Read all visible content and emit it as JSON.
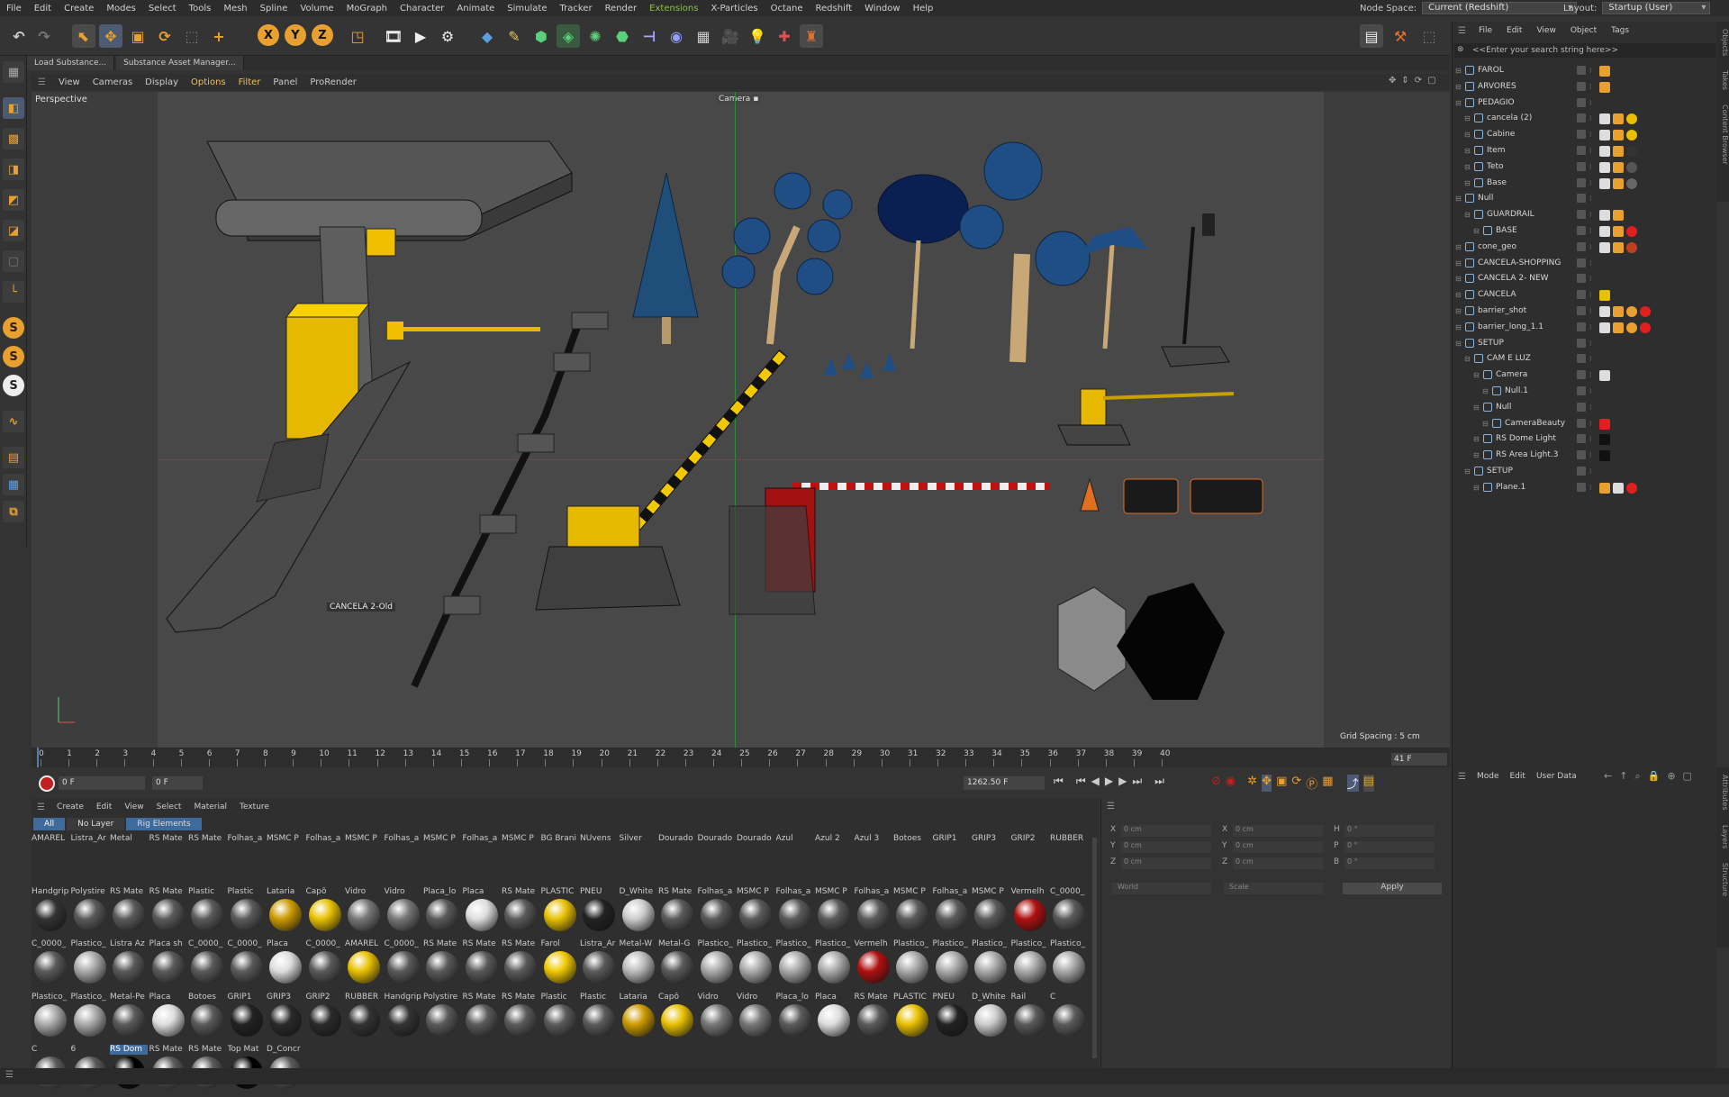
{
  "menubar": {
    "items": [
      "File",
      "Edit",
      "Create",
      "Modes",
      "Select",
      "Tools",
      "Mesh",
      "Spline",
      "Volume",
      "MoGraph",
      "Character",
      "Animate",
      "Simulate",
      "Tracker",
      "Render",
      "Extensions",
      "X-Particles",
      "Octane",
      "Redshift",
      "Window",
      "Help"
    ],
    "node_space_label": "Node Space:",
    "node_space_value": "Current (Redshift)",
    "layout_label": "Layout:",
    "layout_value": "Startup (User)"
  },
  "doc_tabs": [
    "Load Substance...",
    "Substance Asset Manager..."
  ],
  "viewport_menu": [
    "View",
    "Cameras",
    "Display",
    "Options",
    "Filter",
    "Panel",
    "ProRender"
  ],
  "viewport": {
    "name": "Perspective",
    "camera_label": "Camera",
    "grid_spacing": "Grid Spacing : 5 cm",
    "object_label": "CANCELA 2-Old"
  },
  "timeline": {
    "ticks": [
      "0",
      "1",
      "2",
      "3",
      "4",
      "5",
      "6",
      "7",
      "8",
      "9",
      "10",
      "11",
      "12",
      "13",
      "14",
      "15",
      "16",
      "17",
      "18",
      "19",
      "20",
      "21",
      "22",
      "23",
      "24",
      "25",
      "26",
      "27",
      "28",
      "29",
      "30",
      "31",
      "32",
      "33",
      "34",
      "35",
      "36",
      "37",
      "38",
      "39",
      "40"
    ],
    "end_frame": "41 F",
    "current_frame": "0 F",
    "start_field": "0 F",
    "end_field": "1262.50 F"
  },
  "object_manager": {
    "menu": [
      "File",
      "Edit",
      "View",
      "Object",
      "Tags"
    ],
    "search_placeholder": "<<Enter your search string here>>",
    "objects": [
      {
        "name": "FAROL",
        "indent": 0
      },
      {
        "name": "ARVORES",
        "indent": 0
      },
      {
        "name": "PEDAGIO",
        "indent": 0
      },
      {
        "name": "cancela (2)",
        "indent": 1
      },
      {
        "name": "Cabine",
        "indent": 1
      },
      {
        "name": "Item",
        "indent": 1
      },
      {
        "name": "Teto",
        "indent": 1
      },
      {
        "name": "Base",
        "indent": 1
      },
      {
        "name": "Null",
        "indent": 0
      },
      {
        "name": "GUARDRAIL",
        "indent": 1
      },
      {
        "name": "BASE",
        "indent": 2
      },
      {
        "name": "cone_geo",
        "indent": 0
      },
      {
        "name": "CANCELA-SHOPPING",
        "indent": 0
      },
      {
        "name": "CANCELA 2- NEW",
        "indent": 0
      },
      {
        "name": "CANCELA",
        "indent": 0
      },
      {
        "name": "barrier_shot",
        "indent": 0
      },
      {
        "name": "barrier_long_1.1",
        "indent": 0
      },
      {
        "name": "SETUP",
        "indent": 0
      },
      {
        "name": "CAM E LUZ",
        "indent": 1
      },
      {
        "name": "Camera",
        "indent": 2
      },
      {
        "name": "Null.1",
        "indent": 3
      },
      {
        "name": "Null",
        "indent": 2
      },
      {
        "name": "CameraBeauty",
        "indent": 3
      },
      {
        "name": "RS Dome Light",
        "indent": 2
      },
      {
        "name": "RS Area Light.3",
        "indent": 2
      },
      {
        "name": "SETUP",
        "indent": 1
      },
      {
        "name": "Plane.1",
        "indent": 2
      }
    ]
  },
  "side_tabs_top": [
    "Objects",
    "Takes",
    "Content Browser"
  ],
  "side_tabs_bottom": [
    "Attributes",
    "Layers",
    "Structure"
  ],
  "attributes": {
    "menu": [
      "Mode",
      "Edit",
      "User Data"
    ]
  },
  "material_manager": {
    "menu": [
      "Create",
      "Edit",
      "View",
      "Select",
      "Material",
      "Texture"
    ],
    "filters": [
      "All",
      "No Layer",
      "Rig Elements"
    ],
    "rows": [
      [
        "AMAREL",
        "Listra_Ar",
        "Metal",
        "RS Mate",
        "RS Mate",
        "Folhas_a",
        "MSMC P",
        "Folhas_a",
        "MSMC P",
        "Folhas_a",
        "MSMC P",
        "Folhas_a",
        "MSMC P",
        "BG Brani",
        "NUvens",
        "Silver",
        "Dourado",
        "Dourado",
        "Dourado",
        "Azul",
        "Azul 2",
        "Azul 3",
        "Botoes",
        "GRIP1",
        "GRIP3",
        "GRIP2",
        "RUBBER"
      ],
      [
        "Handgrip",
        "Polystire",
        "RS Mate",
        "RS Mate",
        "Plastic",
        "Plastic",
        "Lataria",
        "Capô",
        "Vidro",
        "Vidro",
        "Placa_lo",
        "Placa",
        "RS Mate",
        "PLASTIC",
        "PNEU",
        "D_White",
        "RS Mate",
        "Folhas_a",
        "MSMC P",
        "Folhas_a",
        "MSMC P",
        "Folhas_a",
        "MSMC P",
        "Folhas_a",
        "MSMC P",
        "Vermelh",
        "C_0000_"
      ],
      [
        "C_0000_",
        "Plastico_",
        "Listra Az",
        "Placa sh",
        "C_0000_",
        "C_0000_",
        "Placa",
        "C_0000_",
        "AMAREL",
        "C_0000_",
        "RS Mate",
        "RS Mate",
        "RS Mate",
        "Farol",
        "Listra_Ar",
        "Metal-W",
        "Metal-G",
        "Plastico_",
        "Plastico_",
        "Plastico_",
        "Plastico_",
        "Vermelh",
        "Plastico_",
        "Plastico_",
        "Plastico_",
        "Plastico_",
        "Plastico_"
      ],
      [
        "Plastico_",
        "Plastico_",
        "Metal-Pe",
        "Placa",
        "Botoes",
        "GRIP1",
        "GRIP3",
        "GRIP2",
        "RUBBER",
        "Handgrip",
        "Polystire",
        "RS Mate",
        "RS Mate",
        "Plastic",
        "Plastic",
        "Lataria",
        "Capô",
        "Vidro",
        "Vidro",
        "Placa_lo",
        "Placa",
        "RS Mate",
        "PLASTIC",
        "PNEU",
        "D_White",
        "Rail",
        "C"
      ],
      [
        "C",
        "6",
        "RS Dom",
        "RS Mate",
        "RS Mate",
        "Top Mat",
        "D_Concr"
      ]
    ]
  },
  "coords": {
    "x_pos": "0 cm",
    "y_pos": "0 cm",
    "z_pos": "0 cm",
    "x_size": "0 cm",
    "y_size": "0 cm",
    "z_size": "0 cm",
    "h_rot": "0 °",
    "p_rot": "0 °",
    "b_rot": "0 °",
    "space": "World",
    "mode": "Scale",
    "apply": "Apply",
    "h_label": "H",
    "p_label": "P",
    "b_label": "B",
    "x_label": "X",
    "y_label": "Y",
    "z_label": "Z"
  },
  "colors": {
    "accent": "#e8a030",
    "selection": "#3f6a9c",
    "highlight_menu": "#8fc04a"
  }
}
